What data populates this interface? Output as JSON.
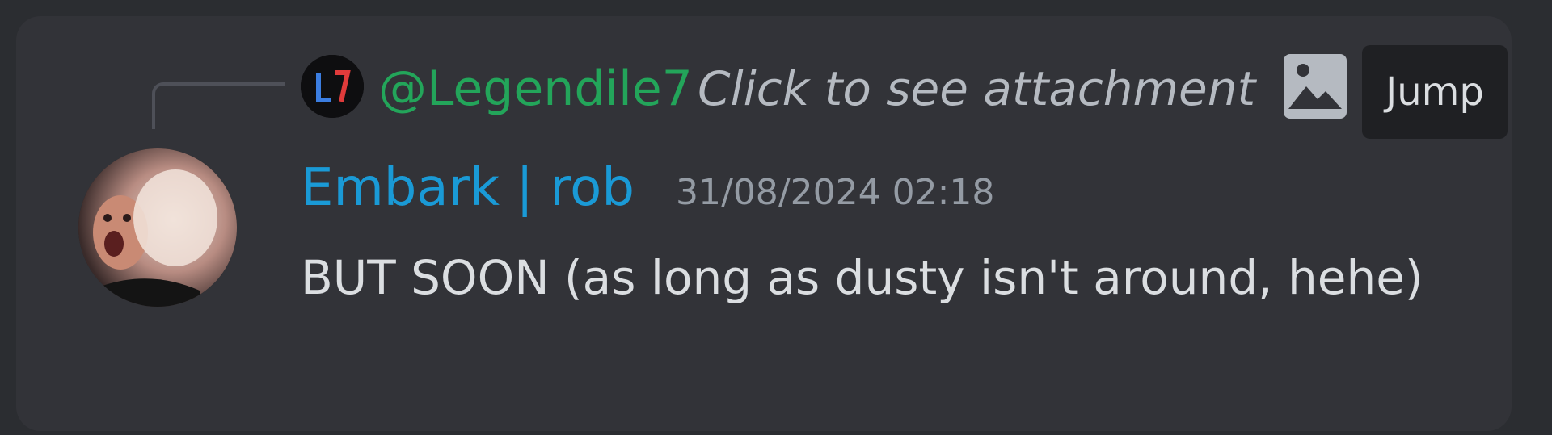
{
  "reply": {
    "username": "@Legendile7",
    "text": "Click to see attachment",
    "jump_label": "Jump"
  },
  "message": {
    "author": "Embark | rob",
    "timestamp": "31/08/2024 02:18",
    "content": "BUT SOON (as long as dusty isn't around, hehe)"
  },
  "colors": {
    "background": "#2b2d31",
    "card": "#323338",
    "reply_username": "#23a55a",
    "author": "#1a9ad6",
    "timestamp": "#949ba4",
    "text": "#dbdee1"
  },
  "icons": {
    "reply_avatar": "legendile7-avatar",
    "attachment": "image-icon",
    "author_avatar": "user-avatar"
  }
}
